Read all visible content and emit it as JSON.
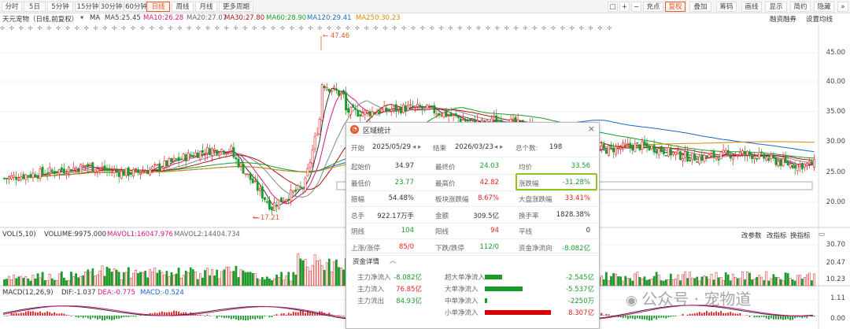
{
  "toolbar": {
    "tabs": [
      "分时",
      "5日",
      "5分钟",
      "15分钟",
      "30分钟",
      "60分钟",
      "日线",
      "周线",
      "月线",
      "更多周期"
    ],
    "active_tab": "日线",
    "right": [
      "充点",
      "复权",
      "叠加",
      "筹码",
      "画线",
      "显示",
      "简约",
      "隐藏"
    ]
  },
  "info": {
    "name": "天元宠物（日线,前复权）",
    "ma_label": "MA",
    "ma5": "MA5:25.45",
    "ma10": "MA10:26.28",
    "ma20": "MA20:27.07",
    "ma30": "MA30:27.80",
    "ma60": "MA60:28.90",
    "ma120": "MA120:29.41",
    "ma250": "MA250:30.23",
    "right1": "融资融券",
    "right2": "设置均线"
  },
  "price": {
    "high_marker": "47.46",
    "low_marker": "17.21",
    "axis": [
      "45.00",
      "40.00",
      "35.00",
      "30.00",
      "25.00",
      "20.00"
    ]
  },
  "vol": {
    "label": "VOL(5,10)",
    "volume": "VOLUME:9975.000",
    "mavol1": "MAVOL1:16047.976",
    "mavol2": "MAVOL2:14404.734",
    "btns": [
      "改参数",
      "改指标",
      "换指标"
    ],
    "axis": [
      "30.70",
      "20.47",
      "10.23"
    ]
  },
  "macd": {
    "label": "MACD(12,26,9)",
    "dif": "DIF:-1.037",
    "dea": "DEA:-0.775",
    "macd": "MACD:-0.524",
    "axis": [
      "1.11",
      "0.00"
    ]
  },
  "popup": {
    "title": "区域统计",
    "start_label": "开始",
    "start_date": "2025/05/29",
    "end_label": "结束",
    "end_date": "2026/03/23",
    "days_label": "总个数:",
    "days": "198",
    "stats": [
      [
        [
          "起始价",
          "34.97",
          ""
        ],
        [
          "最终价",
          "24.03",
          "dn"
        ],
        [
          "均价",
          "33.56",
          "dn"
        ]
      ],
      [
        [
          "最低价",
          "23.77",
          "dn"
        ],
        [
          "最高价",
          "42.82",
          "up"
        ],
        [
          "涨跌幅",
          "-31.28%",
          "dn"
        ]
      ],
      [
        [
          "振幅",
          "54.48%",
          ""
        ],
        [
          "板块涨跌幅",
          "8.67%",
          "up"
        ],
        [
          "大盘涨跌幅",
          "33.41%",
          "up"
        ]
      ],
      [
        [
          "总手",
          "922.17万手",
          ""
        ],
        [
          "金额",
          "309.5亿",
          ""
        ],
        [
          "换手率",
          "1828.38%",
          ""
        ]
      ],
      [
        [
          "阴线",
          "104",
          "dn"
        ],
        [
          "阳线",
          "94",
          "up"
        ],
        [
          "平线",
          "0",
          ""
        ]
      ],
      [
        [
          "上涨/涨停",
          "85/0",
          "up"
        ],
        [
          "下跌/跌停",
          "112/0",
          "dn"
        ],
        [
          "资金净流向",
          "-8.082亿",
          "dn"
        ]
      ]
    ],
    "fund_title": "资金详情",
    "fund_left": [
      [
        "主力净流入",
        "-8.082亿",
        "dn"
      ],
      [
        "主力流入",
        "76.85亿",
        "up"
      ],
      [
        "主力流出",
        "84.93亿",
        "dn"
      ]
    ],
    "fund_right": [
      [
        "超大单净流入",
        "-2.545亿",
        "dn",
        0.26
      ],
      [
        "大单净流入",
        "-5.537亿",
        "dn",
        0.57
      ],
      [
        "中单净流入",
        "-2250万",
        "dn",
        0.03
      ],
      [
        "小单净流入",
        "8.307亿",
        "up",
        1.0
      ]
    ]
  },
  "watermark": "公众号 · 宠物道",
  "colors": {
    "up": "#e02020",
    "down": "#1a9a2a",
    "highlight": "#8fc31f",
    "accent": "#e05a2b"
  }
}
